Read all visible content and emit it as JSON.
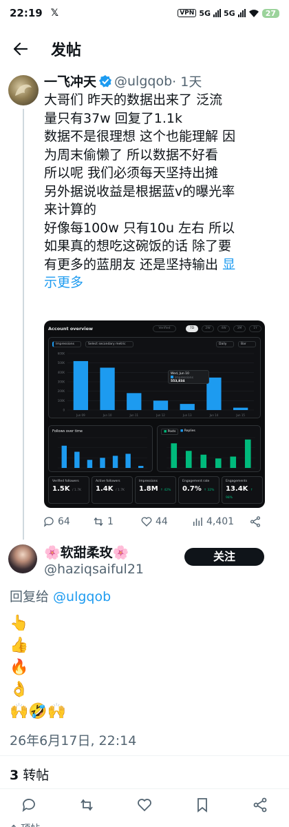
{
  "status_bar": {
    "time": "22:19",
    "notification": "𝕏",
    "vpn": "VPN",
    "net1": "5G",
    "net2": "5G",
    "battery": "27"
  },
  "header": {
    "title": "发帖"
  },
  "tweet": {
    "name": "一飞冲天",
    "handle": "@ulgqob",
    "age": "· 1天",
    "lines": [
      "大哥们  昨天的数据出来了  泛流",
      "量只有37w  回复了1.1k",
      "数据不是很理想  这个也能理解  因",
      "为周末偷懒了  所以数据不好看",
      "所以呢  我们必须每天坚持出摊",
      "另外据说收益是根据蓝v的曝光率",
      "来计算的",
      "好像每100w  只有10u  左右  所以",
      "如果真的想吃这碗饭的话  除了要",
      "有更多的蓝朋友  还是坚持输出 "
    ],
    "more_a": "显",
    "more_b": "示更多",
    "stats": {
      "replies": "64",
      "reposts": "1",
      "likes": "44",
      "views": "4,401"
    }
  },
  "dashboard": {
    "title": "Account overview",
    "verified_toggle": "Verified",
    "ranges": [
      "7D",
      "2W",
      "4W",
      "3M",
      "1Y"
    ],
    "selected_range": "7D",
    "metric": "Impressions",
    "secondary": "Select secondary metric",
    "granularity": "Daily",
    "chart_kind": "Bar",
    "tooltip_date": "Wed, Jun 10",
    "tooltip_label": "Impressions",
    "tooltip_value": "553,834",
    "main_y_ticks": [
      "600K",
      "500K",
      "400K",
      "300K",
      "200K",
      "100K",
      "0"
    ],
    "followers_title": "Follows over time",
    "posts_legend": "Posts",
    "replies_legend": "Replies",
    "cards": [
      {
        "label": "Verified followers",
        "value": "1.5K",
        "sub": "/ 1.7K"
      },
      {
        "label": "Active followers",
        "value": "1.4K",
        "sub": "/ 1.7K"
      },
      {
        "label": "Impressions",
        "value": "1.8M",
        "sub": "↑ 42%"
      },
      {
        "label": "Engagement rate",
        "value": "0.7%",
        "sub": "↑ 32%"
      },
      {
        "label": "Engagements",
        "value": "13.4K",
        "sub": "↑ 98%"
      }
    ]
  },
  "reply": {
    "name": "🌸软甜柔玫🌸",
    "handle": "@haziqsaiful21",
    "follow_label": "关注",
    "replying_prefix": "回复给 ",
    "replying_to": "@ulgqob",
    "emoji_lines": [
      "👆",
      "👍",
      "🔥",
      "👌",
      "🙌🤣🙌"
    ],
    "timestamp": "26年6月17日, 22:14",
    "repost_count": "3",
    "repost_label": " 转帖",
    "peek": "↑ 顶帖"
  },
  "colors": {
    "accent": "#1d9bf0",
    "text": "#0f1419",
    "muted": "#536471",
    "chart_blue": "#1d9bf0",
    "chart_green": "#00ba7c"
  },
  "chart_data": [
    {
      "type": "bar",
      "title": "",
      "ylabel": "",
      "categories": [
        "Jun 09",
        "Jun 10",
        "Jun 11",
        "Jun 12",
        "Jun 13",
        "Jun 14",
        "Jun 15"
      ],
      "values": [
        520000,
        450000,
        180000,
        100000,
        65000,
        345000,
        25000
      ],
      "ylim": [
        0,
        600000
      ]
    },
    {
      "type": "bar",
      "title": "Follows over time",
      "values": [
        11,
        8,
        4,
        5,
        6,
        7,
        1
      ],
      "ylim": [
        0,
        15
      ]
    },
    {
      "type": "bar",
      "title": "",
      "series": [
        {
          "name": "Posts",
          "values": [
            13,
            9,
            7,
            5,
            6,
            15
          ]
        }
      ],
      "ylim": [
        0,
        16
      ]
    }
  ]
}
